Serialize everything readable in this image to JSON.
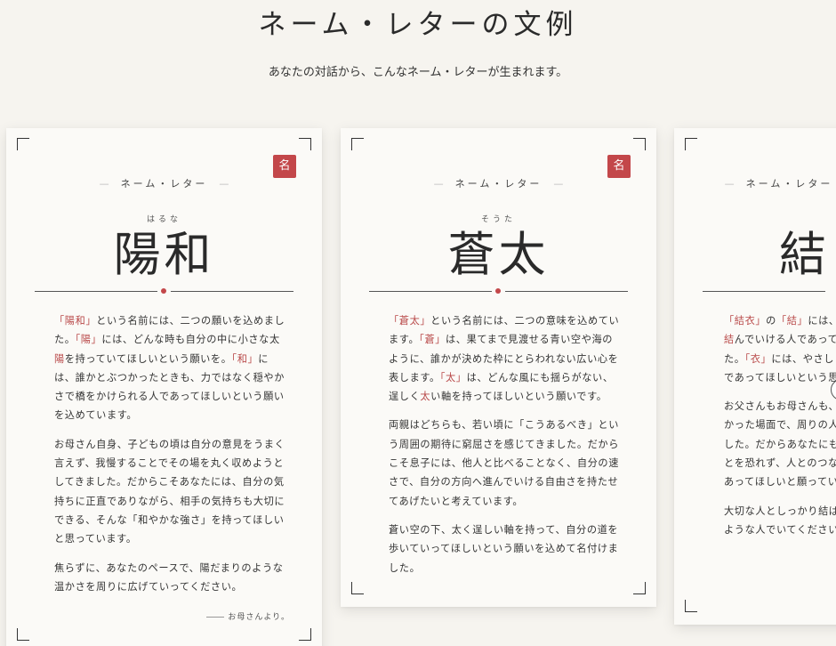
{
  "header": {
    "title": "ネーム・レターの文例",
    "subtitle": "あなたの対話から、こんなネーム・レターが生まれます。"
  },
  "cards": [
    {
      "stamp": "名",
      "label": "ネーム・レター",
      "label_dash": "—",
      "ruby": "はるな",
      "name": "陽和",
      "paragraphs": [
        [
          {
            "t": "「陽和」",
            "h": true
          },
          {
            "t": "という名前には、二つの願いを込めました。"
          },
          {
            "t": "「陽」",
            "h": true
          },
          {
            "t": "には、どんな時も自分の中に小さな太"
          },
          {
            "t": "陽",
            "h": true
          },
          {
            "t": "を持っていてほしいという願いを。"
          },
          {
            "t": "「和」",
            "h": true
          },
          {
            "t": "には、誰かとぶつかったときも、力ではなく穏やかさで橋をかけられる人であってほしいという願いを込めています。"
          }
        ],
        [
          {
            "t": "お母さん自身、子どもの頃は自分の意見をうまく言えず、我慢することでその場を丸く収めようとしてきました。だからこそあなたには、自分の気持ちに正直でありながら、相手の気持ちも大切にできる、そんな「和やかな強さ」を持ってほしいと思っています。"
          }
        ],
        [
          {
            "t": "焦らずに、あなたのペースで、陽だまりのような温かさを周りに広げていってください。"
          }
        ]
      ],
      "signature": "お母さんより。"
    },
    {
      "stamp": "名",
      "label": "ネーム・レター",
      "label_dash": "—",
      "ruby": "そうた",
      "name": "蒼太",
      "paragraphs": [
        [
          {
            "t": "「蒼太」",
            "h": true
          },
          {
            "t": "という名前には、二つの意味を込めています。"
          },
          {
            "t": "「蒼」",
            "h": true
          },
          {
            "t": "は、果てまで見渡せる青い空や海のように、誰かが決めた枠にとらわれない広い心を表します。"
          },
          {
            "t": "「太」",
            "h": true
          },
          {
            "t": "は、どんな風にも揺らがない、逞しく"
          },
          {
            "t": "太",
            "h": true
          },
          {
            "t": "い軸を持ってほしいという願いです。"
          }
        ],
        [
          {
            "t": "両親はどちらも、若い頃に「こうあるべき」という周囲の期待に窮屈さを感じてきました。だからこそ息子には、他人と比べることなく、自分の速さで、自分の方向へ進んでいける自由さを持たせてあげたいと考えています。"
          }
        ],
        [
          {
            "t": "蒼い空の下、太く逞しい軸を持って、自分の道を歩いていってほしいという願いを込めて名付けました。"
          }
        ]
      ]
    },
    {
      "label": "ネーム・レター",
      "label_dash": "—",
      "name": "結",
      "paragraphs": [
        [
          {
            "t": "「結衣」",
            "h": true
          },
          {
            "t": "の"
          },
          {
            "t": "「結」",
            "h": true
          },
          {
            "t": "には、人と人を結ぶような縁を"
          },
          {
            "t": "結",
            "h": true
          },
          {
            "t": "んでいける人であってほしい願いを込めました。"
          },
          {
            "t": "「衣」",
            "h": true
          },
          {
            "t": "には、やさしく包む、あたたかな存在であってほしいという思いを重ねています。"
          }
        ],
        [
          {
            "t": "お父さんもお母さんも、一人では乗り越えられなかった場面で、周りの人に助けられて越えてきました。だからあなたにも、頼ることや頼られることを恐れず、人とのつながりを大切にできる人であってほしいと願っています。"
          }
        ],
        [
          {
            "t": "大切な人としっかり結ばれながら、やさしい衣のような人でいてください。"
          }
        ]
      ]
    }
  ]
}
